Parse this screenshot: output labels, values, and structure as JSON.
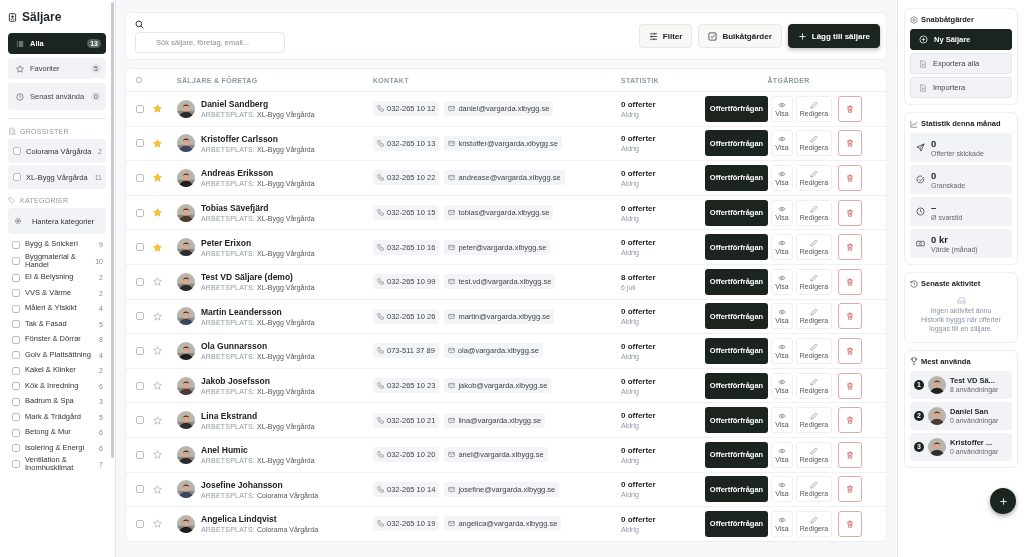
{
  "sidebar": {
    "title": "Säljare",
    "views": [
      {
        "label": "Alla",
        "count": "13",
        "kind": "all",
        "selected": true
      },
      {
        "label": "Favoriter",
        "count": "5",
        "kind": "favorites",
        "selected": false
      },
      {
        "label": "Senast använda",
        "count": "0",
        "kind": "recent",
        "selected": false
      }
    ],
    "wholesalers": {
      "heading": "GROSSISTER",
      "items": [
        {
          "label": "Colorama Vårgårda",
          "count": "2",
          "checked": false
        },
        {
          "label": "XL-Bygg Vårgårda",
          "count": "11",
          "checked": false
        }
      ]
    },
    "categories": {
      "heading": "KATEGORIER",
      "manage_button": "Hantera kategorier",
      "items": [
        {
          "label": "Bygg & Snickeri",
          "count": "9",
          "checked": false
        },
        {
          "label": "Byggmaterial & Handel",
          "count": "10",
          "checked": false
        },
        {
          "label": "El & Belysning",
          "count": "2",
          "checked": false
        },
        {
          "label": "VVS & Värme",
          "count": "2",
          "checked": false
        },
        {
          "label": "Måleri & Ytskikt",
          "count": "4",
          "checked": false
        },
        {
          "label": "Tak & Fasad",
          "count": "5",
          "checked": false
        },
        {
          "label": "Fönster & Dörrar",
          "count": "8",
          "checked": false
        },
        {
          "label": "Golv & Plattsättning",
          "count": "4",
          "checked": false
        },
        {
          "label": "Kakel & Klinker",
          "count": "2",
          "checked": false
        },
        {
          "label": "Kök & Inredning",
          "count": "6",
          "checked": false
        },
        {
          "label": "Badrum & Spa",
          "count": "3",
          "checked": false
        },
        {
          "label": "Mark & Trädgård",
          "count": "5",
          "checked": false
        },
        {
          "label": "Betong & Mur",
          "count": "6",
          "checked": false
        },
        {
          "label": "Isolering & Energi",
          "count": "6",
          "checked": false
        },
        {
          "label": "Ventilation & Inomhusklimat",
          "count": "7",
          "checked": false
        }
      ]
    }
  },
  "toolbar": {
    "search": {
      "placeholder": "Sök säljare, företag, email..."
    },
    "buttons": [
      {
        "label": "Filter",
        "kind": "filter"
      },
      {
        "label": "Bulkåtgärder",
        "kind": "bulk"
      },
      {
        "label": "Lägg till säljare",
        "kind": "add"
      }
    ]
  },
  "table": {
    "select_all": {
      "checked": false
    },
    "columns": [
      "SÄLJARE & FÖRETAG",
      "KONTAKT",
      "STATISTIK",
      "ÅTGÄRDER"
    ],
    "rows": [
      {
        "checked": false,
        "favorite": true,
        "name": "Daniel Sandberg",
        "workplace_label": "ARBETSPLATS:",
        "workplace": "XL-Bygg Vårgårda",
        "phone": "032-265 10 12",
        "email": "daniel@vargarda.xlbygg.se",
        "offers": "0 offerter",
        "last": "Aldrig",
        "actions": [
          "Offertförfrågan",
          "Visa",
          "Redigera"
        ]
      },
      {
        "checked": false,
        "favorite": true,
        "name": "Kristoffer Carlsson",
        "workplace_label": "ARBETSPLATS:",
        "workplace": "XL-Bygg Vårgårda",
        "phone": "032-265 10 13",
        "email": "kristoffer@vargarda.xlbygg.se",
        "offers": "0 offerter",
        "last": "Aldrig",
        "actions": [
          "Offertförfrågan",
          "Visa",
          "Redigera"
        ]
      },
      {
        "checked": false,
        "favorite": true,
        "name": "Andreas Eriksson",
        "workplace_label": "ARBETSPLATS:",
        "workplace": "XL-Bygg Vårgårda",
        "phone": "032-265 10 22",
        "email": "andrease@vargarda.xlbygg.se",
        "offers": "0 offerter",
        "last": "Aldrig",
        "actions": [
          "Offertförfrågan",
          "Visa",
          "Redigera"
        ]
      },
      {
        "checked": false,
        "favorite": true,
        "name": "Tobias Sävefjärd",
        "workplace_label": "ARBETSPLATS:",
        "workplace": "XL-Bygg Vårgårda",
        "phone": "032-265 10 15",
        "email": "tobias@vargarda.xlbygg.se",
        "offers": "0 offerter",
        "last": "Aldrig",
        "actions": [
          "Offertförfrågan",
          "Visa",
          "Redigera"
        ]
      },
      {
        "checked": false,
        "favorite": true,
        "name": "Peter Erixon",
        "workplace_label": "ARBETSPLATS:",
        "workplace": "XL-Bygg Vårgårda",
        "phone": "032-265 10 16",
        "email": "peter@vargarda.xlbygg.se",
        "offers": "0 offerter",
        "last": "Aldrig",
        "actions": [
          "Offertförfrågan",
          "Visa",
          "Redigera"
        ]
      },
      {
        "checked": false,
        "favorite": false,
        "name": "Test VD Säljare (demo)",
        "workplace_label": "ARBETSPLATS:",
        "workplace": "XL-Bygg Vårgårda",
        "phone": "032-265 10 99",
        "email": "test.vd@vargarda.xlbygg.se",
        "offers": "8 offerter",
        "last": "6 juli",
        "actions": [
          "Offertförfrågan",
          "Visa",
          "Redigera"
        ]
      },
      {
        "checked": false,
        "favorite": false,
        "name": "Martin Leandersson",
        "workplace_label": "ARBETSPLATS:",
        "workplace": "XL-Bygg Vårgårda",
        "phone": "032-265 10 26",
        "email": "martin@vargarda.xlbygg.se",
        "offers": "0 offerter",
        "last": "Aldrig",
        "actions": [
          "Offertförfrågan",
          "Visa",
          "Redigera"
        ]
      },
      {
        "checked": false,
        "favorite": false,
        "name": "Ola Gunnarsson",
        "workplace_label": "ARBETSPLATS:",
        "workplace": "XL-Bygg Vårgårda",
        "phone": "073-511 37 89",
        "email": "ola@vargarda.xlbygg.se",
        "offers": "0 offerter",
        "last": "Aldrig",
        "actions": [
          "Offertförfrågan",
          "Visa",
          "Redigera"
        ]
      },
      {
        "checked": false,
        "favorite": false,
        "name": "Jakob Josefsson",
        "workplace_label": "ARBETSPLATS:",
        "workplace": "XL-Bygg Vårgårda",
        "phone": "032-265 10 23",
        "email": "jakob@vargarda.xlbygg.se",
        "offers": "0 offerter",
        "last": "Aldrig",
        "actions": [
          "Offertförfrågan",
          "Visa",
          "Redigera"
        ]
      },
      {
        "checked": false,
        "favorite": false,
        "name": "Lina Ekstrand",
        "workplace_label": "ARBETSPLATS:",
        "workplace": "XL-Bygg Vårgårda",
        "phone": "032-265 10 21",
        "email": "lina@vargarda.xlbygg.se",
        "offers": "0 offerter",
        "last": "Aldrig",
        "actions": [
          "Offertförfrågan",
          "Visa",
          "Redigera"
        ]
      },
      {
        "checked": false,
        "favorite": false,
        "name": "Anel Humic",
        "workplace_label": "ARBETSPLATS:",
        "workplace": "XL-Bygg Vårgårda",
        "phone": "032-265 10 20",
        "email": "anel@vargarda.xlbygg.se",
        "offers": "0 offerter",
        "last": "Aldrig",
        "actions": [
          "Offertförfrågan",
          "Visa",
          "Redigera"
        ]
      },
      {
        "checked": false,
        "favorite": false,
        "name": "Josefine Johansson",
        "workplace_label": "ARBETSPLATS:",
        "workplace": "Colorama Vårgårda",
        "phone": "032-265 10 14",
        "email": "josefine@vargarda.xlbygg.se",
        "offers": "0 offerter",
        "last": "Aldrig",
        "actions": [
          "Offertförfrågan",
          "Visa",
          "Redigera"
        ]
      },
      {
        "checked": false,
        "favorite": false,
        "name": "Angelica Lindqvist",
        "workplace_label": "ARBETSPLATS:",
        "workplace": "Colorama Vårgårda",
        "phone": "032-265 10 19",
        "email": "angelica@vargarda.xlbygg.se",
        "offers": "0 offerter",
        "last": "Aldrig",
        "actions": [
          "Offertförfrågan",
          "Visa",
          "Redigera"
        ]
      }
    ]
  },
  "quick_actions": {
    "title": "Snabbåtgärder",
    "buttons": [
      {
        "label": "Ny Säljare",
        "kind": "new"
      },
      {
        "label": "Exportera alla",
        "kind": "export"
      },
      {
        "label": "Importera",
        "kind": "import"
      }
    ]
  },
  "monthly_stats": {
    "title": "Statistik denna månad",
    "items": [
      {
        "value": "0",
        "label": "Offerter skickade",
        "kind": "sent"
      },
      {
        "value": "0",
        "label": "Granskade",
        "kind": "reviewed"
      },
      {
        "value": "–",
        "label": "Ø svarstid",
        "kind": "time"
      },
      {
        "value": "0 kr",
        "label": "Värde (månad)",
        "kind": "value"
      }
    ]
  },
  "recent_activity": {
    "title": "Senaste aktivitet",
    "empty_title": "Ingen aktivitet ännu",
    "empty_text": "Historik byggs när offerter loggas till en säljare."
  },
  "most_used": {
    "title": "Mest använda",
    "items": [
      {
        "rank": "1",
        "name": "Test VD Sä...",
        "uses": "8 användningar"
      },
      {
        "rank": "2",
        "name": "Daniel San",
        "uses": "0 användningar"
      },
      {
        "rank": "3",
        "name": "Kristoffer ...",
        "uses": "0 användningar"
      }
    ]
  }
}
